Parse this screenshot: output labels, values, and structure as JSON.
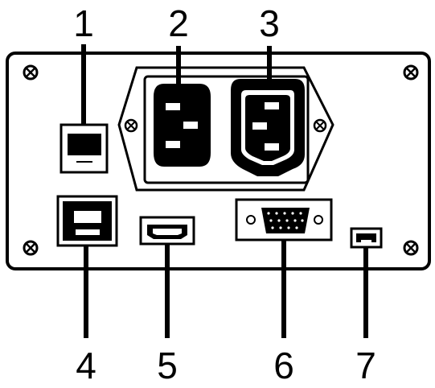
{
  "callouts": {
    "c1": "1",
    "c2": "2",
    "c3": "3",
    "c4": "4",
    "c5": "5",
    "c6": "6",
    "c7": "7"
  },
  "colors": {
    "ink": "#000000",
    "paper": "#ffffff"
  },
  "icons": {
    "screw": "cross-head-screw-icon",
    "modular_jack": "rj-jack-icon",
    "power_inlet": "iec-inlet-icon",
    "hdmi": "hdmi-port-icon",
    "vga": "d-sub-connector-icon",
    "usb_b": "usb-b-port-icon"
  }
}
